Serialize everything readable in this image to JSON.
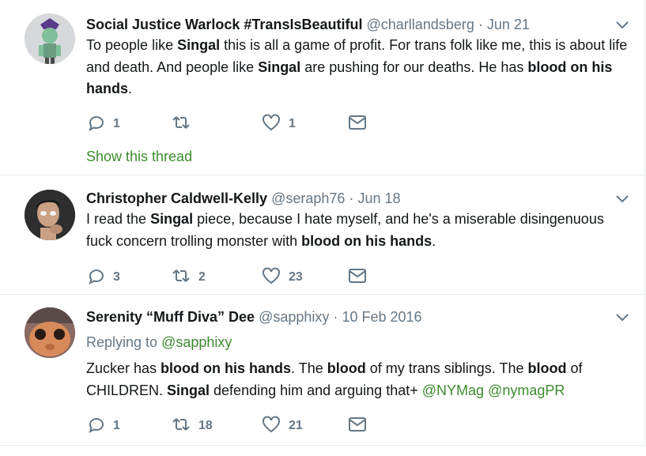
{
  "tweets": [
    {
      "name": "Social Justice Warlock #TransIsBeautiful",
      "handle": "@charllandsberg",
      "date": "Jun 21",
      "text_parts": [
        {
          "t": "To people like "
        },
        {
          "t": "Singal",
          "b": true
        },
        {
          "t": " this is all a game of profit. For trans folk like me, this is about life and death. And people like "
        },
        {
          "t": "Singal",
          "b": true
        },
        {
          "t": " are pushing for our deaths. He has "
        },
        {
          "t": "blood on his hands",
          "b": true
        },
        {
          "t": "."
        }
      ],
      "replies": "1",
      "retweets": "",
      "likes": "1",
      "show_thread": "Show this thread"
    },
    {
      "name": "Christopher Caldwell-Kelly",
      "handle": "@seraph76",
      "date": "Jun 18",
      "text_parts": [
        {
          "t": "I read the "
        },
        {
          "t": "Singal",
          "b": true
        },
        {
          "t": " piece, because I hate myself, and he's a miserable disingenuous fuck concern trolling monster with "
        },
        {
          "t": "blood on his hands",
          "b": true
        },
        {
          "t": "."
        }
      ],
      "replies": "3",
      "retweets": "2",
      "likes": "23"
    },
    {
      "name": "Serenity “Muff Diva” Dee",
      "handle": "@sapphixy",
      "date": "10 Feb 2016",
      "replying_label": "Replying to",
      "replying_to": "@sapphixy",
      "text_parts": [
        {
          "t": "Zucker has "
        },
        {
          "t": "blood on his hands",
          "b": true
        },
        {
          "t": ". The "
        },
        {
          "t": "blood",
          "b": true
        },
        {
          "t": " of my trans siblings. The "
        },
        {
          "t": "blood",
          "b": true
        },
        {
          "t": " of CHILDREN. "
        },
        {
          "t": "Singal",
          "b": true
        },
        {
          "t": " defending him and arguing that+ "
        },
        {
          "t": "@NYMag",
          "link": true
        },
        {
          "t": " "
        },
        {
          "t": "@nymagPR",
          "link": true
        }
      ],
      "replies": "1",
      "retweets": "18",
      "likes": "21"
    }
  ],
  "colors": {
    "link": "#3d8b2f",
    "muted": "#657786",
    "border": "#e6ecf0"
  },
  "icons": [
    "reply-icon",
    "retweet-icon",
    "like-icon",
    "dm-icon",
    "chevron-down-icon"
  ]
}
